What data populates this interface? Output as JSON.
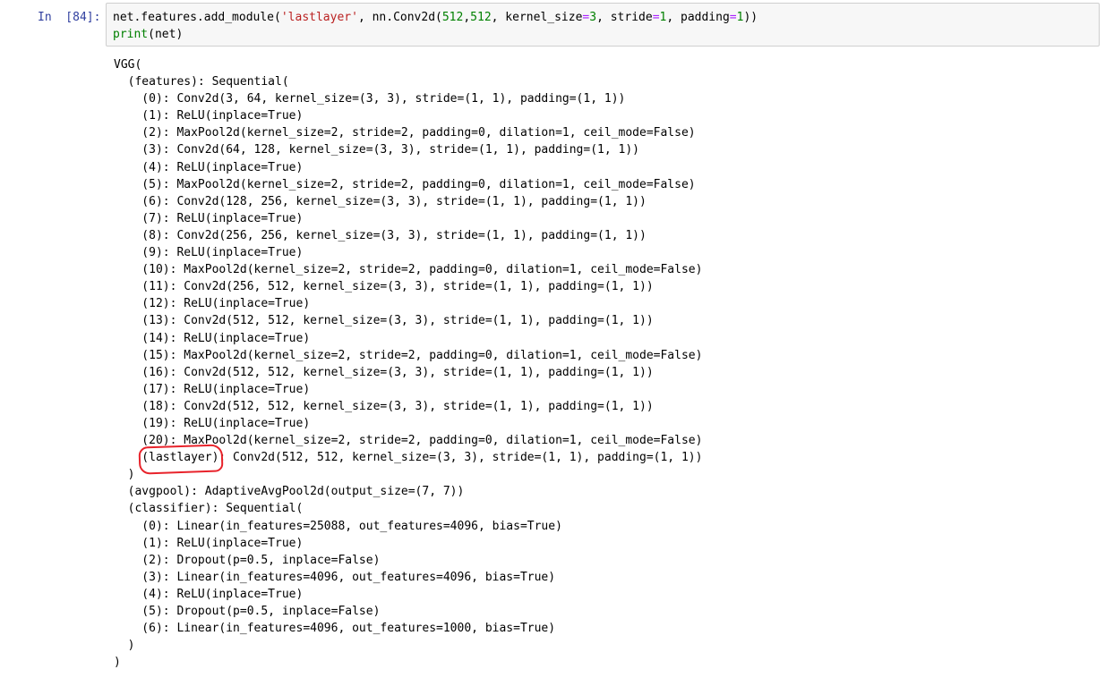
{
  "cell": {
    "prompt": "In  [84]:",
    "code_line_1": {
      "prefix": "net.features.add_module(",
      "string": "'lastlayer'",
      "mid1": ", nn.Conv2d(",
      "n1": "512",
      "comma": ",",
      "n2": "512",
      "mid2": ", kernel_size",
      "eq1": "=",
      "n3": "3",
      "mid3": ", stride",
      "eq2": "=",
      "n4": "1",
      "mid4": ", padding",
      "eq3": "=",
      "n5": "1",
      "suffix": "))"
    },
    "code_line_2": {
      "keyword": "print",
      "args": "(net)"
    }
  },
  "output": {
    "lines": [
      "VGG(",
      "  (features): Sequential(",
      "    (0): Conv2d(3, 64, kernel_size=(3, 3), stride=(1, 1), padding=(1, 1))",
      "    (1): ReLU(inplace=True)",
      "    (2): MaxPool2d(kernel_size=2, stride=2, padding=0, dilation=1, ceil_mode=False)",
      "    (3): Conv2d(64, 128, kernel_size=(3, 3), stride=(1, 1), padding=(1, 1))",
      "    (4): ReLU(inplace=True)",
      "    (5): MaxPool2d(kernel_size=2, stride=2, padding=0, dilation=1, ceil_mode=False)",
      "    (6): Conv2d(128, 256, kernel_size=(3, 3), stride=(1, 1), padding=(1, 1))",
      "    (7): ReLU(inplace=True)",
      "    (8): Conv2d(256, 256, kernel_size=(3, 3), stride=(1, 1), padding=(1, 1))",
      "    (9): ReLU(inplace=True)",
      "    (10): MaxPool2d(kernel_size=2, stride=2, padding=0, dilation=1, ceil_mode=False)",
      "    (11): Conv2d(256, 512, kernel_size=(3, 3), stride=(1, 1), padding=(1, 1))",
      "    (12): ReLU(inplace=True)",
      "    (13): Conv2d(512, 512, kernel_size=(3, 3), stride=(1, 1), padding=(1, 1))",
      "    (14): ReLU(inplace=True)",
      "    (15): MaxPool2d(kernel_size=2, stride=2, padding=0, dilation=1, ceil_mode=False)",
      "    (16): Conv2d(512, 512, kernel_size=(3, 3), stride=(1, 1), padding=(1, 1))",
      "    (17): ReLU(inplace=True)",
      "    (18): Conv2d(512, 512, kernel_size=(3, 3), stride=(1, 1), padding=(1, 1))",
      "    (19): ReLU(inplace=True)",
      "    (20): MaxPool2d(kernel_size=2, stride=2, padding=0, dilation=1, ceil_mode=False)",
      "    (lastlayer): Conv2d(512, 512, kernel_size=(3, 3), stride=(1, 1), padding=(1, 1))",
      "  )",
      "  (avgpool): AdaptiveAvgPool2d(output_size=(7, 7))",
      "  (classifier): Sequential(",
      "    (0): Linear(in_features=25088, out_features=4096, bias=True)",
      "    (1): ReLU(inplace=True)",
      "    (2): Dropout(p=0.5, inplace=False)",
      "    (3): Linear(in_features=4096, out_features=4096, bias=True)",
      "    (4): ReLU(inplace=True)",
      "    (5): Dropout(p=0.5, inplace=False)",
      "    (6): Linear(in_features=4096, out_features=1000, bias=True)",
      "  )",
      ")"
    ]
  },
  "colors": {
    "prompt": "#303f9f",
    "string": "#ba2121",
    "operator": "#aa22ff",
    "number": "#008000",
    "keyword": "#008000",
    "annotation": "#e8232b",
    "input_background": "#f7f7f7"
  },
  "annotation": {
    "type": "hand-drawn-circle",
    "target_text": "(lastlayer)"
  }
}
